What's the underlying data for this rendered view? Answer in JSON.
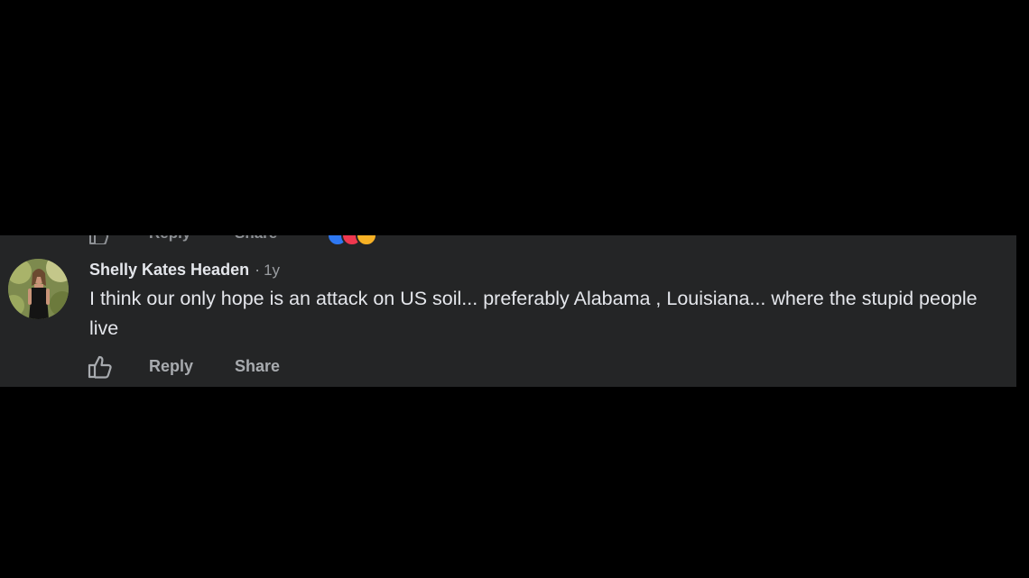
{
  "previous_comment": {
    "reply_label": "Reply",
    "share_label": "Share",
    "reaction_icons": [
      "like-reaction-icon",
      "love-reaction-icon",
      "haha-reaction-icon"
    ],
    "reaction_colors": [
      "#2e78f2",
      "#f0384f",
      "#f7b125"
    ]
  },
  "comment": {
    "author": "Shelly Kates Headen",
    "separator": "·",
    "timestamp": "1y",
    "text": "I think our only hope is an attack on US soil... preferably Alabama , Louisiana... where the stupid people live",
    "actions": {
      "like_icon": "thumbs-up-icon",
      "reply_label": "Reply",
      "share_label": "Share"
    }
  },
  "colors": {
    "background": "#000000",
    "panel": "#242526",
    "primary_text": "#e4e6eb",
    "secondary_text": "#a8abaf"
  }
}
